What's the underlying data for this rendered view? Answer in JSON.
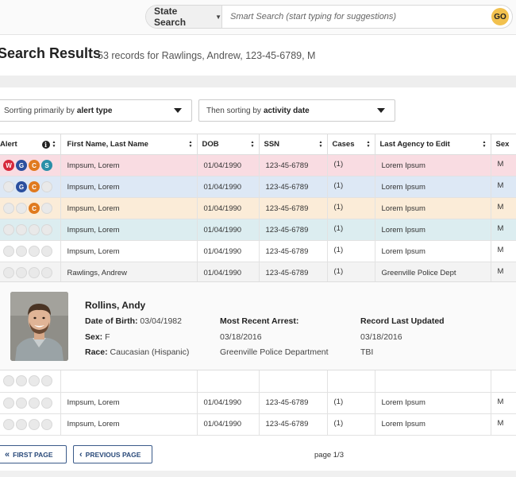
{
  "search": {
    "state_label": "State Search",
    "placeholder": "Smart Search (start typing for suggestions)",
    "go_label": "GO"
  },
  "results": {
    "title": "Search Results",
    "subtitle": "53 records for Rawlings, Andrew, 123-45-6789, M"
  },
  "sorting": {
    "primary_prefix": "Sorrting primarily by",
    "primary_value": "alert type",
    "secondary_prefix": "Then sorting by",
    "secondary_value": "activity date"
  },
  "table": {
    "headers": {
      "alert": "Alert",
      "name": "First Name, Last Name",
      "dob": "DOB",
      "ssn": "SSN",
      "cases": "Cases",
      "agency": "Last Agency to Edit",
      "sex": "Sex"
    },
    "rows": [
      {
        "name": "Impsum, Lorem",
        "dob": "01/04/1990",
        "ssn": "123-45-6789",
        "cases": "(1)",
        "agency": "Lorem Ipsum",
        "sex": "M"
      },
      {
        "name": "Impsum, Lorem",
        "dob": "01/04/1990",
        "ssn": "123-45-6789",
        "cases": "(1)",
        "agency": "Lorem Ipsum",
        "sex": "M"
      },
      {
        "name": "Impsum, Lorem",
        "dob": "01/04/1990",
        "ssn": "123-45-6789",
        "cases": "(1)",
        "agency": "Lorem Ipsum",
        "sex": "M"
      },
      {
        "name": "Impsum, Lorem",
        "dob": "01/04/1990",
        "ssn": "123-45-6789",
        "cases": "(1)",
        "agency": "Lorem Ipsum",
        "sex": "M"
      },
      {
        "name": "Impsum, Lorem",
        "dob": "01/04/1990",
        "ssn": "123-45-6789",
        "cases": "(1)",
        "agency": "Lorem Ipsum",
        "sex": "M"
      },
      {
        "name": "Rawlings, Andrew",
        "dob": "01/04/1990",
        "ssn": "123-45-6789",
        "cases": "(1)",
        "agency": "Greenville Police Dept",
        "sex": "M"
      }
    ],
    "rows_after": [
      {
        "name": "",
        "dob": "",
        "ssn": "",
        "cases": "",
        "agency": "",
        "sex": ""
      },
      {
        "name": "Impsum, Lorem",
        "dob": "01/04/1990",
        "ssn": "123-45-6789",
        "cases": "(1)",
        "agency": "Lorem Ipsum",
        "sex": "M"
      },
      {
        "name": "Impsum, Lorem",
        "dob": "01/04/1990",
        "ssn": "123-45-6789",
        "cases": "(1)",
        "agency": "Lorem Ipsum",
        "sex": "M"
      }
    ]
  },
  "alerts": {
    "W": {
      "letter": "W",
      "color": "#d6283b"
    },
    "G": {
      "letter": "G",
      "color": "#2b4f9e"
    },
    "C": {
      "letter": "C",
      "color": "#e07a1f"
    },
    "S": {
      "letter": "S",
      "color": "#2a8fa8"
    }
  },
  "detail": {
    "name": "Rollins, Andy",
    "dob_label": "Date of Birth:",
    "dob_value": "03/04/1982",
    "sex_label": "Sex:",
    "sex_value": "F",
    "race_label": "Race:",
    "race_value": "Caucasian (Hispanic)",
    "arrest_label": "Most Recent Arrest:",
    "arrest_date": "03/18/2016",
    "arrest_agency": "Greenville Police Department",
    "updated_label": "Record Last Updated",
    "updated_date": "03/18/2016",
    "updated_by": "TBI"
  },
  "pager": {
    "first_label": "FIRST PAGE",
    "prev_label": "PREVIOUS PAGE",
    "page_info": "page 1/3"
  }
}
